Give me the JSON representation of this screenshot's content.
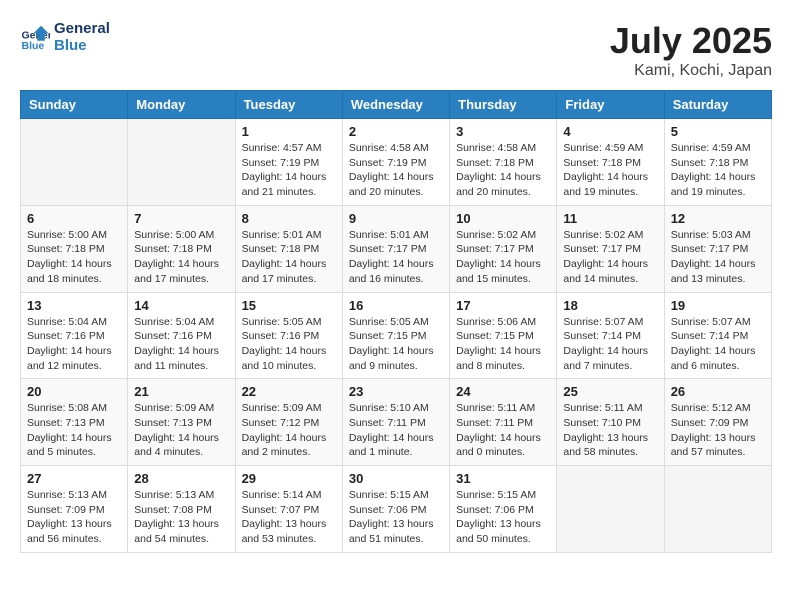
{
  "header": {
    "logo_line1": "General",
    "logo_line2": "Blue",
    "month": "July 2025",
    "location": "Kami, Kochi, Japan"
  },
  "weekdays": [
    "Sunday",
    "Monday",
    "Tuesday",
    "Wednesday",
    "Thursday",
    "Friday",
    "Saturday"
  ],
  "weeks": [
    [
      {
        "day": "",
        "info": ""
      },
      {
        "day": "",
        "info": ""
      },
      {
        "day": "1",
        "info": "Sunrise: 4:57 AM\nSunset: 7:19 PM\nDaylight: 14 hours and 21 minutes."
      },
      {
        "day": "2",
        "info": "Sunrise: 4:58 AM\nSunset: 7:19 PM\nDaylight: 14 hours and 20 minutes."
      },
      {
        "day": "3",
        "info": "Sunrise: 4:58 AM\nSunset: 7:18 PM\nDaylight: 14 hours and 20 minutes."
      },
      {
        "day": "4",
        "info": "Sunrise: 4:59 AM\nSunset: 7:18 PM\nDaylight: 14 hours and 19 minutes."
      },
      {
        "day": "5",
        "info": "Sunrise: 4:59 AM\nSunset: 7:18 PM\nDaylight: 14 hours and 19 minutes."
      }
    ],
    [
      {
        "day": "6",
        "info": "Sunrise: 5:00 AM\nSunset: 7:18 PM\nDaylight: 14 hours and 18 minutes."
      },
      {
        "day": "7",
        "info": "Sunrise: 5:00 AM\nSunset: 7:18 PM\nDaylight: 14 hours and 17 minutes."
      },
      {
        "day": "8",
        "info": "Sunrise: 5:01 AM\nSunset: 7:18 PM\nDaylight: 14 hours and 17 minutes."
      },
      {
        "day": "9",
        "info": "Sunrise: 5:01 AM\nSunset: 7:17 PM\nDaylight: 14 hours and 16 minutes."
      },
      {
        "day": "10",
        "info": "Sunrise: 5:02 AM\nSunset: 7:17 PM\nDaylight: 14 hours and 15 minutes."
      },
      {
        "day": "11",
        "info": "Sunrise: 5:02 AM\nSunset: 7:17 PM\nDaylight: 14 hours and 14 minutes."
      },
      {
        "day": "12",
        "info": "Sunrise: 5:03 AM\nSunset: 7:17 PM\nDaylight: 14 hours and 13 minutes."
      }
    ],
    [
      {
        "day": "13",
        "info": "Sunrise: 5:04 AM\nSunset: 7:16 PM\nDaylight: 14 hours and 12 minutes."
      },
      {
        "day": "14",
        "info": "Sunrise: 5:04 AM\nSunset: 7:16 PM\nDaylight: 14 hours and 11 minutes."
      },
      {
        "day": "15",
        "info": "Sunrise: 5:05 AM\nSunset: 7:16 PM\nDaylight: 14 hours and 10 minutes."
      },
      {
        "day": "16",
        "info": "Sunrise: 5:05 AM\nSunset: 7:15 PM\nDaylight: 14 hours and 9 minutes."
      },
      {
        "day": "17",
        "info": "Sunrise: 5:06 AM\nSunset: 7:15 PM\nDaylight: 14 hours and 8 minutes."
      },
      {
        "day": "18",
        "info": "Sunrise: 5:07 AM\nSunset: 7:14 PM\nDaylight: 14 hours and 7 minutes."
      },
      {
        "day": "19",
        "info": "Sunrise: 5:07 AM\nSunset: 7:14 PM\nDaylight: 14 hours and 6 minutes."
      }
    ],
    [
      {
        "day": "20",
        "info": "Sunrise: 5:08 AM\nSunset: 7:13 PM\nDaylight: 14 hours and 5 minutes."
      },
      {
        "day": "21",
        "info": "Sunrise: 5:09 AM\nSunset: 7:13 PM\nDaylight: 14 hours and 4 minutes."
      },
      {
        "day": "22",
        "info": "Sunrise: 5:09 AM\nSunset: 7:12 PM\nDaylight: 14 hours and 2 minutes."
      },
      {
        "day": "23",
        "info": "Sunrise: 5:10 AM\nSunset: 7:11 PM\nDaylight: 14 hours and 1 minute."
      },
      {
        "day": "24",
        "info": "Sunrise: 5:11 AM\nSunset: 7:11 PM\nDaylight: 14 hours and 0 minutes."
      },
      {
        "day": "25",
        "info": "Sunrise: 5:11 AM\nSunset: 7:10 PM\nDaylight: 13 hours and 58 minutes."
      },
      {
        "day": "26",
        "info": "Sunrise: 5:12 AM\nSunset: 7:09 PM\nDaylight: 13 hours and 57 minutes."
      }
    ],
    [
      {
        "day": "27",
        "info": "Sunrise: 5:13 AM\nSunset: 7:09 PM\nDaylight: 13 hours and 56 minutes."
      },
      {
        "day": "28",
        "info": "Sunrise: 5:13 AM\nSunset: 7:08 PM\nDaylight: 13 hours and 54 minutes."
      },
      {
        "day": "29",
        "info": "Sunrise: 5:14 AM\nSunset: 7:07 PM\nDaylight: 13 hours and 53 minutes."
      },
      {
        "day": "30",
        "info": "Sunrise: 5:15 AM\nSunset: 7:06 PM\nDaylight: 13 hours and 51 minutes."
      },
      {
        "day": "31",
        "info": "Sunrise: 5:15 AM\nSunset: 7:06 PM\nDaylight: 13 hours and 50 minutes."
      },
      {
        "day": "",
        "info": ""
      },
      {
        "day": "",
        "info": ""
      }
    ]
  ]
}
